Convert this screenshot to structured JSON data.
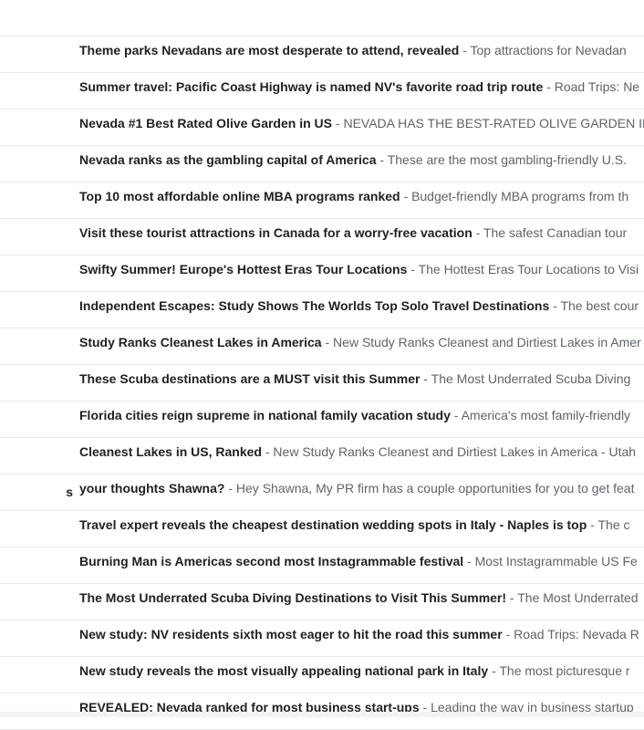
{
  "separator": " - ",
  "emails": [
    {
      "sender": "",
      "subject": "Theme parks Nevadans are most desperate to attend, revealed",
      "snippet": "Top attractions for Nevadan"
    },
    {
      "sender": "",
      "subject": "Summer travel: Pacific Coast Highway is named NV's favorite road trip route",
      "snippet": "Road Trips: Ne"
    },
    {
      "sender": "",
      "subject": "Nevada #1 Best Rated Olive Garden in US",
      "snippet": "NEVADA HAS THE BEST-RATED OLIVE GARDEN IN T"
    },
    {
      "sender": "",
      "subject": "Nevada ranks as the gambling capital of America",
      "snippet": "These are the most gambling-friendly U.S."
    },
    {
      "sender": "",
      "subject": "Top 10 most affordable online MBA programs ranked",
      "snippet": "Budget-friendly MBA programs from th"
    },
    {
      "sender": "",
      "subject": "Visit these tourist attractions in Canada for a worry-free vacation",
      "snippet": "The safest Canadian tour"
    },
    {
      "sender": "",
      "subject": "Swifty Summer! Europe's Hottest Eras Tour Locations",
      "snippet": "The Hottest Eras Tour Locations to Visi"
    },
    {
      "sender": "",
      "subject": "Independent Escapes: Study Shows The Worlds Top Solo Travel Destinations",
      "snippet": "The best cour"
    },
    {
      "sender": "",
      "subject": "Study Ranks Cleanest Lakes in America",
      "snippet": "New Study Ranks Cleanest and Dirtiest Lakes in Amer"
    },
    {
      "sender": "",
      "subject": "These Scuba destinations are a MUST visit this Summer",
      "snippet": "The Most Underrated Scuba Diving"
    },
    {
      "sender": "",
      "subject": "Florida cities reign supreme in national family vacation study",
      "snippet": "America's most family-friendly"
    },
    {
      "sender": "",
      "subject": "Cleanest Lakes in US, Ranked",
      "snippet": "New Study Ranks Cleanest and Dirtiest Lakes in America - Utah"
    },
    {
      "sender": "s",
      "subject": "your thoughts Shawna?",
      "snippet": "Hey Shawna, My PR firm has a couple opportunities for you to get feat"
    },
    {
      "sender": "",
      "subject": "Travel expert reveals the cheapest destination wedding spots in Italy - Naples is top",
      "snippet": "The c"
    },
    {
      "sender": "",
      "subject": "Burning Man is Americas second most Instagrammable festival",
      "snippet": "Most Instagrammable US Fe"
    },
    {
      "sender": "",
      "subject": "The Most Underrated Scuba Diving Destinations to Visit This Summer!",
      "snippet": "The Most Underrated"
    },
    {
      "sender": "",
      "subject": "New study: NV residents sixth most eager to hit the road this summer",
      "snippet": "Road Trips: Nevada R"
    },
    {
      "sender": "",
      "subject": "New study reveals the most visually appealing national park in Italy",
      "snippet": "The most picturesque r"
    },
    {
      "sender": "",
      "subject": "REVEALED: Nevada ranked for most business start-ups",
      "snippet": "Leading the way in business startup"
    }
  ]
}
